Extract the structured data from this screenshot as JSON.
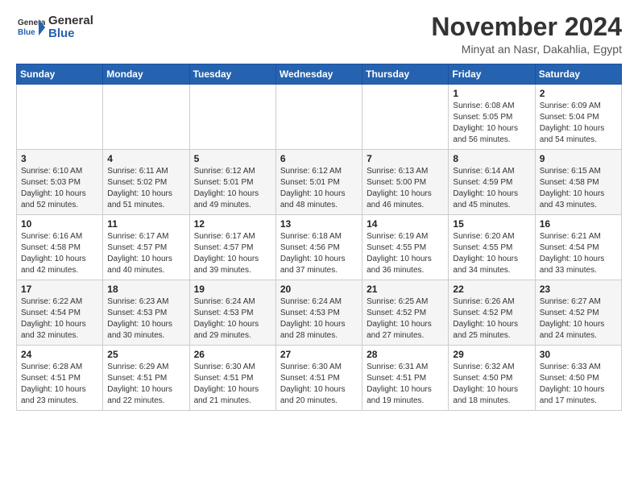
{
  "header": {
    "logo_general": "General",
    "logo_blue": "Blue",
    "month_title": "November 2024",
    "subtitle": "Minyat an Nasr, Dakahlia, Egypt"
  },
  "calendar": {
    "days_of_week": [
      "Sunday",
      "Monday",
      "Tuesday",
      "Wednesday",
      "Thursday",
      "Friday",
      "Saturday"
    ],
    "weeks": [
      [
        {
          "day": "",
          "info": ""
        },
        {
          "day": "",
          "info": ""
        },
        {
          "day": "",
          "info": ""
        },
        {
          "day": "",
          "info": ""
        },
        {
          "day": "",
          "info": ""
        },
        {
          "day": "1",
          "info": "Sunrise: 6:08 AM\nSunset: 5:05 PM\nDaylight: 10 hours and 56 minutes."
        },
        {
          "day": "2",
          "info": "Sunrise: 6:09 AM\nSunset: 5:04 PM\nDaylight: 10 hours and 54 minutes."
        }
      ],
      [
        {
          "day": "3",
          "info": "Sunrise: 6:10 AM\nSunset: 5:03 PM\nDaylight: 10 hours and 52 minutes."
        },
        {
          "day": "4",
          "info": "Sunrise: 6:11 AM\nSunset: 5:02 PM\nDaylight: 10 hours and 51 minutes."
        },
        {
          "day": "5",
          "info": "Sunrise: 6:12 AM\nSunset: 5:01 PM\nDaylight: 10 hours and 49 minutes."
        },
        {
          "day": "6",
          "info": "Sunrise: 6:12 AM\nSunset: 5:01 PM\nDaylight: 10 hours and 48 minutes."
        },
        {
          "day": "7",
          "info": "Sunrise: 6:13 AM\nSunset: 5:00 PM\nDaylight: 10 hours and 46 minutes."
        },
        {
          "day": "8",
          "info": "Sunrise: 6:14 AM\nSunset: 4:59 PM\nDaylight: 10 hours and 45 minutes."
        },
        {
          "day": "9",
          "info": "Sunrise: 6:15 AM\nSunset: 4:58 PM\nDaylight: 10 hours and 43 minutes."
        }
      ],
      [
        {
          "day": "10",
          "info": "Sunrise: 6:16 AM\nSunset: 4:58 PM\nDaylight: 10 hours and 42 minutes."
        },
        {
          "day": "11",
          "info": "Sunrise: 6:17 AM\nSunset: 4:57 PM\nDaylight: 10 hours and 40 minutes."
        },
        {
          "day": "12",
          "info": "Sunrise: 6:17 AM\nSunset: 4:57 PM\nDaylight: 10 hours and 39 minutes."
        },
        {
          "day": "13",
          "info": "Sunrise: 6:18 AM\nSunset: 4:56 PM\nDaylight: 10 hours and 37 minutes."
        },
        {
          "day": "14",
          "info": "Sunrise: 6:19 AM\nSunset: 4:55 PM\nDaylight: 10 hours and 36 minutes."
        },
        {
          "day": "15",
          "info": "Sunrise: 6:20 AM\nSunset: 4:55 PM\nDaylight: 10 hours and 34 minutes."
        },
        {
          "day": "16",
          "info": "Sunrise: 6:21 AM\nSunset: 4:54 PM\nDaylight: 10 hours and 33 minutes."
        }
      ],
      [
        {
          "day": "17",
          "info": "Sunrise: 6:22 AM\nSunset: 4:54 PM\nDaylight: 10 hours and 32 minutes."
        },
        {
          "day": "18",
          "info": "Sunrise: 6:23 AM\nSunset: 4:53 PM\nDaylight: 10 hours and 30 minutes."
        },
        {
          "day": "19",
          "info": "Sunrise: 6:24 AM\nSunset: 4:53 PM\nDaylight: 10 hours and 29 minutes."
        },
        {
          "day": "20",
          "info": "Sunrise: 6:24 AM\nSunset: 4:53 PM\nDaylight: 10 hours and 28 minutes."
        },
        {
          "day": "21",
          "info": "Sunrise: 6:25 AM\nSunset: 4:52 PM\nDaylight: 10 hours and 27 minutes."
        },
        {
          "day": "22",
          "info": "Sunrise: 6:26 AM\nSunset: 4:52 PM\nDaylight: 10 hours and 25 minutes."
        },
        {
          "day": "23",
          "info": "Sunrise: 6:27 AM\nSunset: 4:52 PM\nDaylight: 10 hours and 24 minutes."
        }
      ],
      [
        {
          "day": "24",
          "info": "Sunrise: 6:28 AM\nSunset: 4:51 PM\nDaylight: 10 hours and 23 minutes."
        },
        {
          "day": "25",
          "info": "Sunrise: 6:29 AM\nSunset: 4:51 PM\nDaylight: 10 hours and 22 minutes."
        },
        {
          "day": "26",
          "info": "Sunrise: 6:30 AM\nSunset: 4:51 PM\nDaylight: 10 hours and 21 minutes."
        },
        {
          "day": "27",
          "info": "Sunrise: 6:30 AM\nSunset: 4:51 PM\nDaylight: 10 hours and 20 minutes."
        },
        {
          "day": "28",
          "info": "Sunrise: 6:31 AM\nSunset: 4:51 PM\nDaylight: 10 hours and 19 minutes."
        },
        {
          "day": "29",
          "info": "Sunrise: 6:32 AM\nSunset: 4:50 PM\nDaylight: 10 hours and 18 minutes."
        },
        {
          "day": "30",
          "info": "Sunrise: 6:33 AM\nSunset: 4:50 PM\nDaylight: 10 hours and 17 minutes."
        }
      ]
    ]
  }
}
